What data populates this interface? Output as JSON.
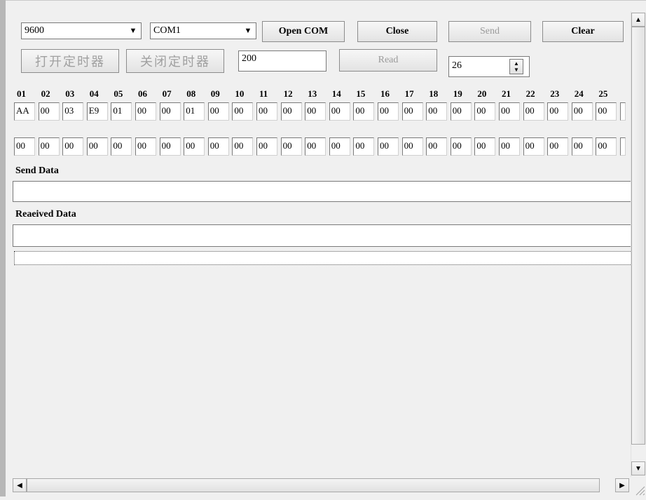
{
  "toolbar": {
    "baud": "9600",
    "port": "COM1",
    "open_com": "Open COM",
    "close": "Close",
    "send": "Send",
    "clear": "Clear",
    "open_timer": "打开定时器",
    "close_timer": "关闭定时器",
    "timer_value": "200",
    "read": "Read",
    "spin_value": "26"
  },
  "columns": [
    "01",
    "02",
    "03",
    "04",
    "05",
    "06",
    "07",
    "08",
    "09",
    "10",
    "11",
    "12",
    "13",
    "14",
    "15",
    "16",
    "17",
    "18",
    "19",
    "20",
    "21",
    "22",
    "23",
    "24",
    "25"
  ],
  "row1": [
    "AA",
    "00",
    "03",
    "E9",
    "01",
    "00",
    "00",
    "01",
    "00",
    "00",
    "00",
    "00",
    "00",
    "00",
    "00",
    "00",
    "00",
    "00",
    "00",
    "00",
    "00",
    "00",
    "00",
    "00",
    "00"
  ],
  "row2": [
    "00",
    "00",
    "00",
    "00",
    "00",
    "00",
    "00",
    "00",
    "00",
    "00",
    "00",
    "00",
    "00",
    "00",
    "00",
    "00",
    "00",
    "00",
    "00",
    "00",
    "00",
    "00",
    "00",
    "00",
    "00"
  ],
  "send_label": "Send Data",
  "received_label": "Reaeived Data",
  "icons": {
    "dropdown": "dropdown-arrow-icon",
    "spin": "spin-arrows-icon",
    "scroll_up": "scroll-up-icon",
    "scroll_down": "scroll-down-icon",
    "scroll_left": "scroll-left-icon",
    "scroll_right": "scroll-right-icon",
    "resize": "resize-grip-icon"
  }
}
